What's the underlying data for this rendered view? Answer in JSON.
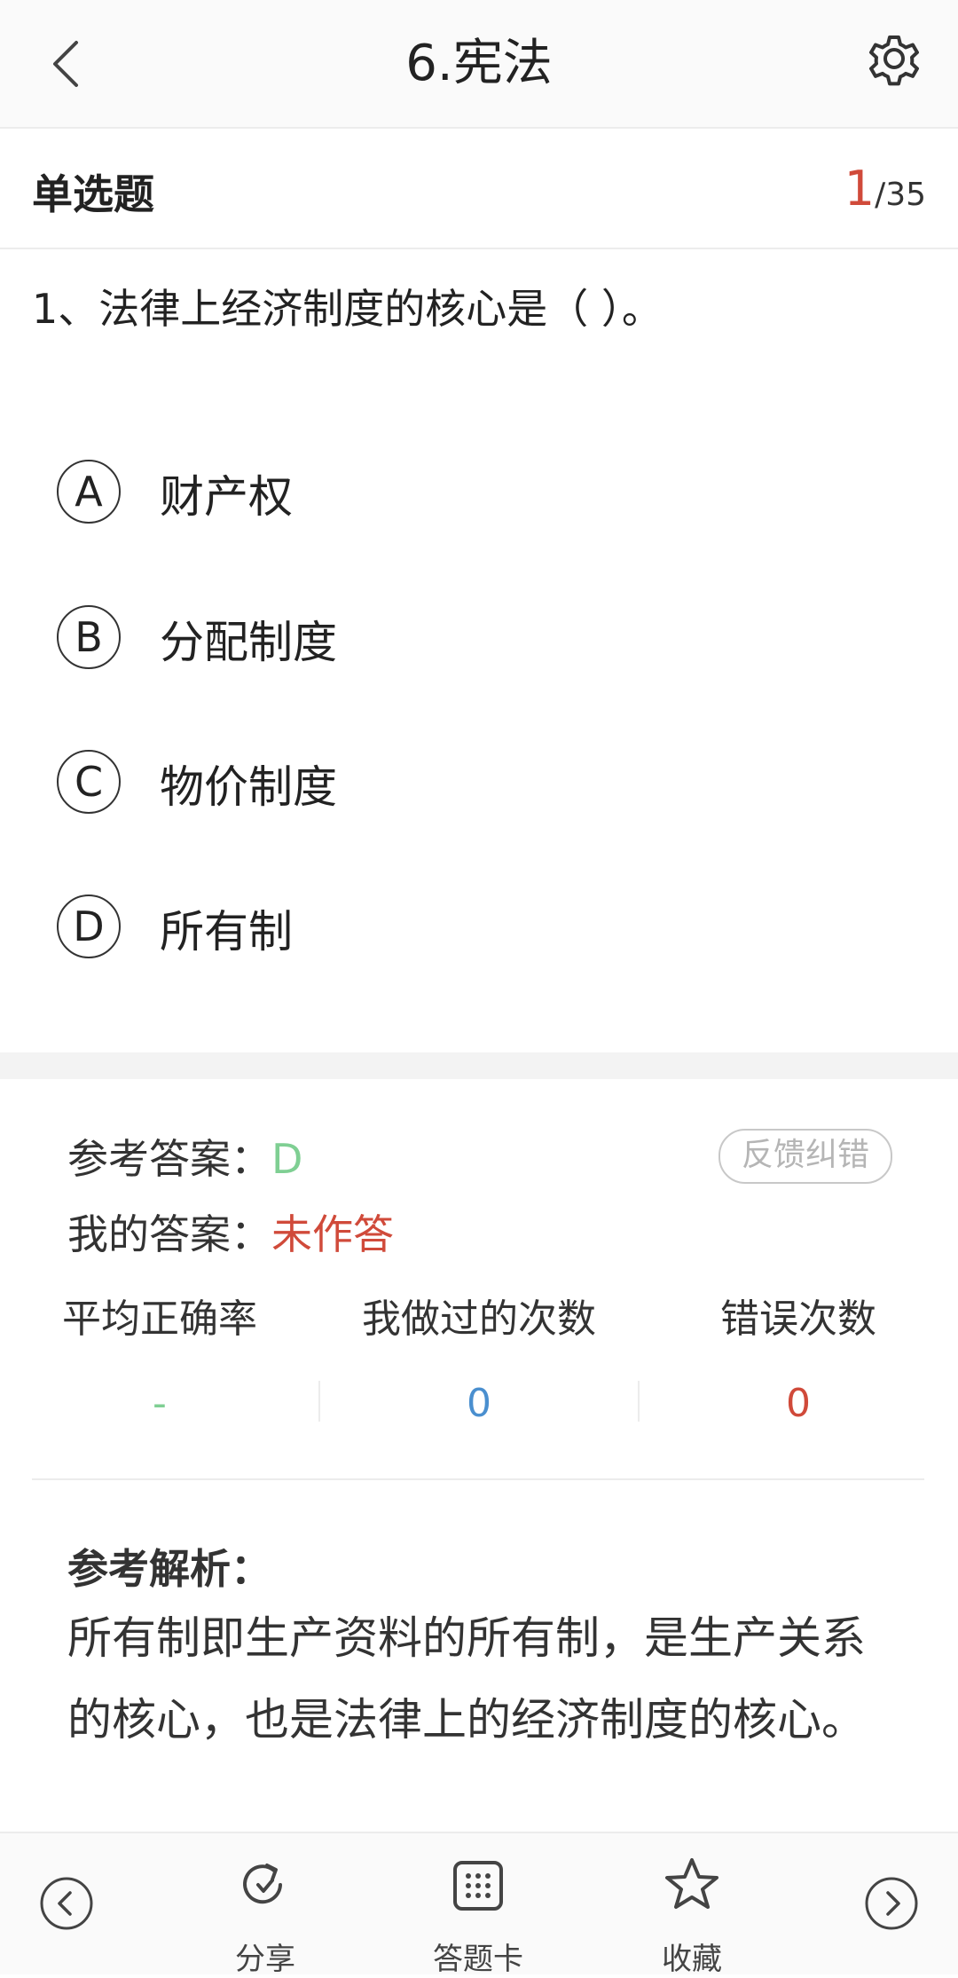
{
  "header": {
    "title": "6.宪法",
    "icons": {
      "back": "chevron-left-icon",
      "settings": "gear-icon"
    }
  },
  "question_bar": {
    "type_label": "单选题",
    "current": "1",
    "total": "/35"
  },
  "question": {
    "text": "1、法律上经济制度的核心是（    ）。",
    "options": [
      {
        "letter": "A",
        "text": "财产权"
      },
      {
        "letter": "B",
        "text": "分配制度"
      },
      {
        "letter": "C",
        "text": "物价制度"
      },
      {
        "letter": "D",
        "text": "所有制"
      }
    ]
  },
  "answer": {
    "reference_label": "参考答案：",
    "reference_value": "D",
    "mine_label": "我的答案：",
    "mine_value": "未作答",
    "feedback_button": "反馈纠错"
  },
  "stats": {
    "headers": [
      "平均正确率",
      "我做过的次数",
      "错误次数"
    ],
    "values": [
      "-",
      "0",
      "0"
    ],
    "value_colors": [
      "#7fcf93",
      "#4a8fcf",
      "#d04a3a"
    ]
  },
  "analysis": {
    "title": "参考解析：",
    "text": "所有制即生产资料的所有制，是生产关系的核心，也是法律上的经济制度的核心。"
  },
  "bottom_nav": {
    "share": "分享",
    "answer_card": "答题卡",
    "favorite": "收藏",
    "icons": [
      "arrow-left-circle-icon",
      "share-icon",
      "grid-icon",
      "star-icon",
      "arrow-right-circle-icon"
    ]
  },
  "colors": {
    "accent_red": "#d04a3a",
    "accent_green": "#7fcf93",
    "accent_blue": "#4a8fcf"
  }
}
